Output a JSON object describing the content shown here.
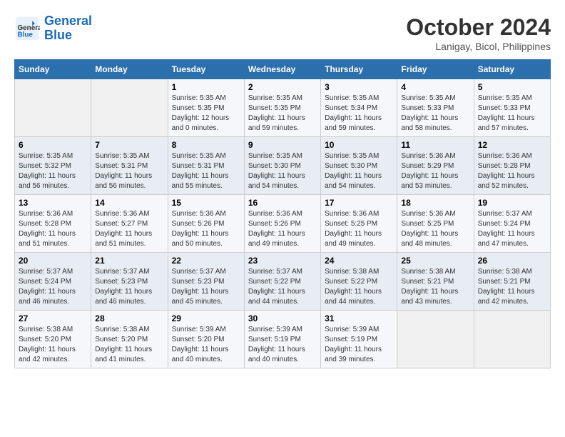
{
  "header": {
    "logo_line1": "General",
    "logo_line2": "Blue",
    "month": "October 2024",
    "location": "Lanigay, Bicol, Philippines"
  },
  "days_of_week": [
    "Sunday",
    "Monday",
    "Tuesday",
    "Wednesday",
    "Thursday",
    "Friday",
    "Saturday"
  ],
  "weeks": [
    [
      {
        "num": "",
        "sunrise": "",
        "sunset": "",
        "daylight": ""
      },
      {
        "num": "",
        "sunrise": "",
        "sunset": "",
        "daylight": ""
      },
      {
        "num": "1",
        "sunrise": "Sunrise: 5:35 AM",
        "sunset": "Sunset: 5:35 PM",
        "daylight": "Daylight: 12 hours and 0 minutes."
      },
      {
        "num": "2",
        "sunrise": "Sunrise: 5:35 AM",
        "sunset": "Sunset: 5:35 PM",
        "daylight": "Daylight: 11 hours and 59 minutes."
      },
      {
        "num": "3",
        "sunrise": "Sunrise: 5:35 AM",
        "sunset": "Sunset: 5:34 PM",
        "daylight": "Daylight: 11 hours and 59 minutes."
      },
      {
        "num": "4",
        "sunrise": "Sunrise: 5:35 AM",
        "sunset": "Sunset: 5:33 PM",
        "daylight": "Daylight: 11 hours and 58 minutes."
      },
      {
        "num": "5",
        "sunrise": "Sunrise: 5:35 AM",
        "sunset": "Sunset: 5:33 PM",
        "daylight": "Daylight: 11 hours and 57 minutes."
      }
    ],
    [
      {
        "num": "6",
        "sunrise": "Sunrise: 5:35 AM",
        "sunset": "Sunset: 5:32 PM",
        "daylight": "Daylight: 11 hours and 56 minutes."
      },
      {
        "num": "7",
        "sunrise": "Sunrise: 5:35 AM",
        "sunset": "Sunset: 5:31 PM",
        "daylight": "Daylight: 11 hours and 56 minutes."
      },
      {
        "num": "8",
        "sunrise": "Sunrise: 5:35 AM",
        "sunset": "Sunset: 5:31 PM",
        "daylight": "Daylight: 11 hours and 55 minutes."
      },
      {
        "num": "9",
        "sunrise": "Sunrise: 5:35 AM",
        "sunset": "Sunset: 5:30 PM",
        "daylight": "Daylight: 11 hours and 54 minutes."
      },
      {
        "num": "10",
        "sunrise": "Sunrise: 5:35 AM",
        "sunset": "Sunset: 5:30 PM",
        "daylight": "Daylight: 11 hours and 54 minutes."
      },
      {
        "num": "11",
        "sunrise": "Sunrise: 5:36 AM",
        "sunset": "Sunset: 5:29 PM",
        "daylight": "Daylight: 11 hours and 53 minutes."
      },
      {
        "num": "12",
        "sunrise": "Sunrise: 5:36 AM",
        "sunset": "Sunset: 5:28 PM",
        "daylight": "Daylight: 11 hours and 52 minutes."
      }
    ],
    [
      {
        "num": "13",
        "sunrise": "Sunrise: 5:36 AM",
        "sunset": "Sunset: 5:28 PM",
        "daylight": "Daylight: 11 hours and 51 minutes."
      },
      {
        "num": "14",
        "sunrise": "Sunrise: 5:36 AM",
        "sunset": "Sunset: 5:27 PM",
        "daylight": "Daylight: 11 hours and 51 minutes."
      },
      {
        "num": "15",
        "sunrise": "Sunrise: 5:36 AM",
        "sunset": "Sunset: 5:26 PM",
        "daylight": "Daylight: 11 hours and 50 minutes."
      },
      {
        "num": "16",
        "sunrise": "Sunrise: 5:36 AM",
        "sunset": "Sunset: 5:26 PM",
        "daylight": "Daylight: 11 hours and 49 minutes."
      },
      {
        "num": "17",
        "sunrise": "Sunrise: 5:36 AM",
        "sunset": "Sunset: 5:25 PM",
        "daylight": "Daylight: 11 hours and 49 minutes."
      },
      {
        "num": "18",
        "sunrise": "Sunrise: 5:36 AM",
        "sunset": "Sunset: 5:25 PM",
        "daylight": "Daylight: 11 hours and 48 minutes."
      },
      {
        "num": "19",
        "sunrise": "Sunrise: 5:37 AM",
        "sunset": "Sunset: 5:24 PM",
        "daylight": "Daylight: 11 hours and 47 minutes."
      }
    ],
    [
      {
        "num": "20",
        "sunrise": "Sunrise: 5:37 AM",
        "sunset": "Sunset: 5:24 PM",
        "daylight": "Daylight: 11 hours and 46 minutes."
      },
      {
        "num": "21",
        "sunrise": "Sunrise: 5:37 AM",
        "sunset": "Sunset: 5:23 PM",
        "daylight": "Daylight: 11 hours and 46 minutes."
      },
      {
        "num": "22",
        "sunrise": "Sunrise: 5:37 AM",
        "sunset": "Sunset: 5:23 PM",
        "daylight": "Daylight: 11 hours and 45 minutes."
      },
      {
        "num": "23",
        "sunrise": "Sunrise: 5:37 AM",
        "sunset": "Sunset: 5:22 PM",
        "daylight": "Daylight: 11 hours and 44 minutes."
      },
      {
        "num": "24",
        "sunrise": "Sunrise: 5:38 AM",
        "sunset": "Sunset: 5:22 PM",
        "daylight": "Daylight: 11 hours and 44 minutes."
      },
      {
        "num": "25",
        "sunrise": "Sunrise: 5:38 AM",
        "sunset": "Sunset: 5:21 PM",
        "daylight": "Daylight: 11 hours and 43 minutes."
      },
      {
        "num": "26",
        "sunrise": "Sunrise: 5:38 AM",
        "sunset": "Sunset: 5:21 PM",
        "daylight": "Daylight: 11 hours and 42 minutes."
      }
    ],
    [
      {
        "num": "27",
        "sunrise": "Sunrise: 5:38 AM",
        "sunset": "Sunset: 5:20 PM",
        "daylight": "Daylight: 11 hours and 42 minutes."
      },
      {
        "num": "28",
        "sunrise": "Sunrise: 5:38 AM",
        "sunset": "Sunset: 5:20 PM",
        "daylight": "Daylight: 11 hours and 41 minutes."
      },
      {
        "num": "29",
        "sunrise": "Sunrise: 5:39 AM",
        "sunset": "Sunset: 5:20 PM",
        "daylight": "Daylight: 11 hours and 40 minutes."
      },
      {
        "num": "30",
        "sunrise": "Sunrise: 5:39 AM",
        "sunset": "Sunset: 5:19 PM",
        "daylight": "Daylight: 11 hours and 40 minutes."
      },
      {
        "num": "31",
        "sunrise": "Sunrise: 5:39 AM",
        "sunset": "Sunset: 5:19 PM",
        "daylight": "Daylight: 11 hours and 39 minutes."
      },
      {
        "num": "",
        "sunrise": "",
        "sunset": "",
        "daylight": ""
      },
      {
        "num": "",
        "sunrise": "",
        "sunset": "",
        "daylight": ""
      }
    ]
  ]
}
